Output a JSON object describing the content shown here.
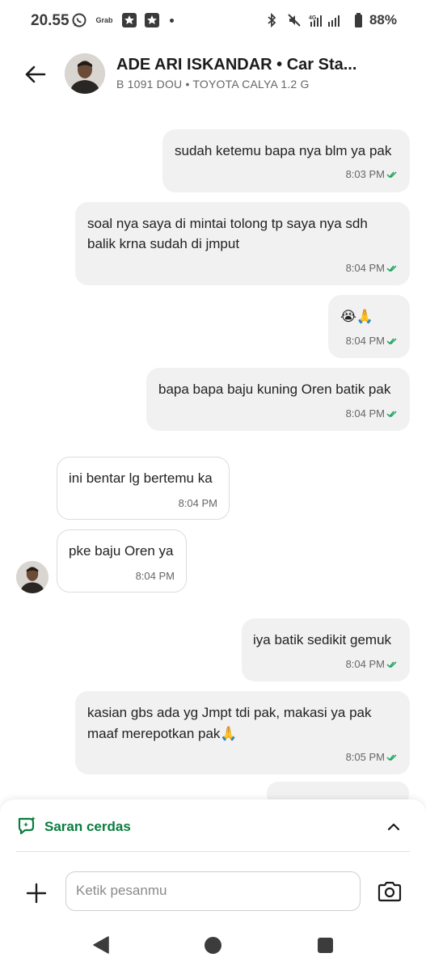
{
  "status_bar": {
    "time": "20.55",
    "app_label": "Grab",
    "battery": "88%"
  },
  "header": {
    "title": "ADE ARI ISKANDAR • Car Sta...",
    "subtitle": "B 1091 DOU • TOYOTA CALYA 1.2 G"
  },
  "messages": [
    {
      "direction": "out",
      "lines": [
        "sudah ketemu bapa nya blm ya pak"
      ],
      "time": "8:03 PM",
      "read": true
    },
    {
      "direction": "out",
      "lines": [
        "soal nya saya di mintai tolong tp saya nya sdh",
        "balik krna sudah di jmput"
      ],
      "time": "8:04 PM",
      "read": true
    },
    {
      "direction": "out",
      "lines": [
        "😭🙏"
      ],
      "time": "8:04 PM",
      "read": true
    },
    {
      "direction": "out",
      "lines": [
        "bapa bapa baju kuning Oren batik pak"
      ],
      "time": "8:04 PM",
      "read": true
    },
    {
      "direction": "in",
      "lines": [
        "ini bentar lg bertemu ka"
      ],
      "time": "8:04 PM"
    },
    {
      "direction": "in",
      "lines": [
        "pke baju Oren ya"
      ],
      "time": "8:04 PM"
    },
    {
      "direction": "out",
      "lines": [
        "iya batik sedikit gemuk"
      ],
      "time": "8:04 PM",
      "read": true
    },
    {
      "direction": "out",
      "lines": [
        "kasian gbs ada yg Jmpt tdi pak, makasi ya pak",
        "maaf merepotkan pak🙏"
      ],
      "time": "8:05 PM",
      "read": true
    }
  ],
  "smart_reply": {
    "label": "Saran cerdas"
  },
  "composer": {
    "placeholder": "Ketik pesanmu"
  },
  "colors": {
    "accent_green": "#0a7d3e",
    "read_tick": "#1aa35a",
    "outgoing_bubble": "#f1f1f1"
  },
  "icons": [
    "back-arrow-icon",
    "smart-reply-icon",
    "chevron-up-icon",
    "plus-icon",
    "camera-icon",
    "nav-back-icon",
    "nav-home-icon",
    "nav-recent-icon"
  ]
}
